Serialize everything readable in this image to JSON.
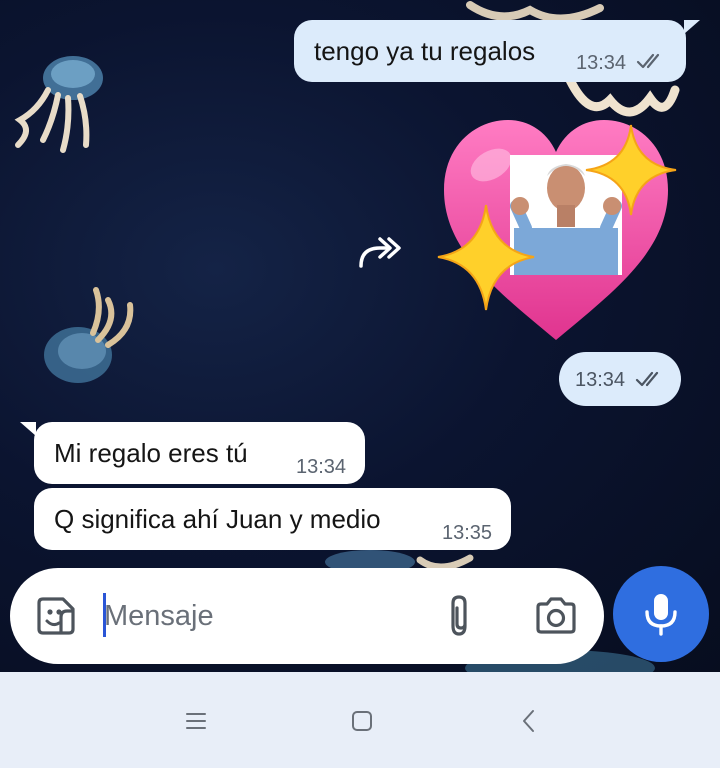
{
  "messages": [
    {
      "direction": "outgoing",
      "type": "text",
      "text": "tengo ya tu regalos",
      "time": "13:34",
      "status": "read"
    },
    {
      "direction": "outgoing",
      "type": "sticker",
      "sticker": "heart-with-sparkles-and-man-pointing",
      "forwarded": true,
      "time": "13:34",
      "status": "read"
    },
    {
      "direction": "incoming",
      "type": "text",
      "text": "Mi regalo eres tú",
      "time": "13:34"
    },
    {
      "direction": "incoming",
      "type": "text",
      "text": "Q significa ahí Juan y medio",
      "time": "13:35"
    }
  ],
  "composer": {
    "placeholder": "Mensaje",
    "emoji_icon": "sticker-smiley-icon",
    "attach_icon": "paperclip-icon",
    "camera_icon": "camera-icon",
    "mic_icon": "microphone-icon"
  },
  "navbar": {
    "menu_icon": "menu-lines-icon",
    "home_icon": "home-square-icon",
    "back_icon": "back-chevron-icon"
  },
  "colors": {
    "outgoing_bubble": "#dcebfb",
    "incoming_bubble": "#ffffff",
    "accent": "#2f6ee0",
    "heart": "#ee4fa8",
    "sparkle": "#ffd02a"
  }
}
